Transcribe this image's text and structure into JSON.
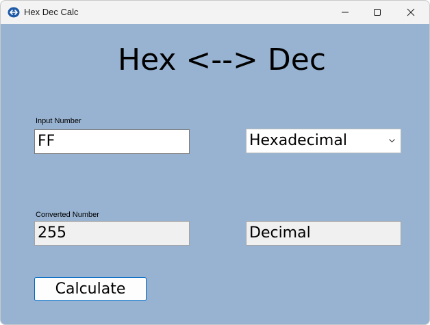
{
  "window": {
    "title": "Hex Dec Calc",
    "controls": {
      "minimize": "minimize",
      "maximize": "maximize",
      "close": "close"
    }
  },
  "main": {
    "heading": "Hex <--> Dec",
    "input": {
      "label": "Input Number",
      "value": "FF"
    },
    "input_base": {
      "selected": "Hexadecimal"
    },
    "output": {
      "label": "Converted Number",
      "value": "255"
    },
    "output_base": {
      "value": "Decimal"
    },
    "calculate_label": "Calculate"
  },
  "colors": {
    "background": "#98b3d1",
    "titlebar": "#f3f3f3",
    "button_border": "#0067c0",
    "app_icon": "#1e5aa8"
  }
}
